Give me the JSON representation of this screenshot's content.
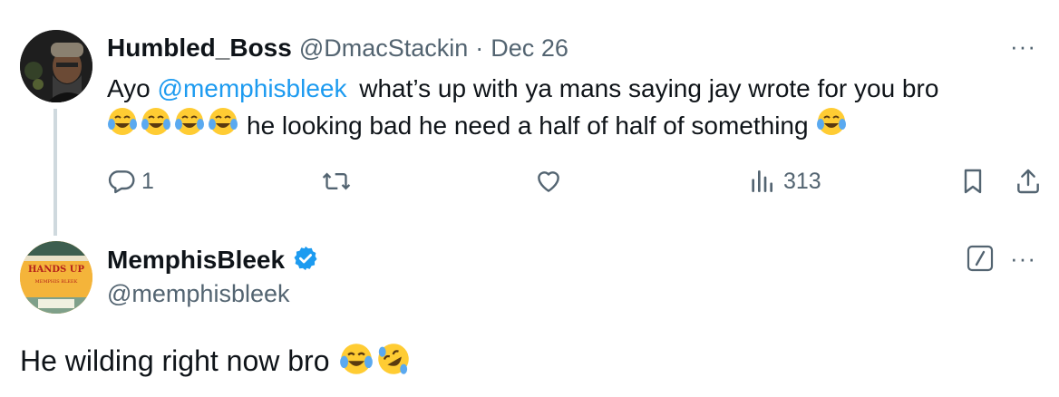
{
  "tweet1": {
    "display_name": "Humbled_Boss",
    "handle": "@DmacStackin",
    "separator": "·",
    "date": "Dec 26",
    "text_part1": "Ayo",
    "mention": "@memphisbleek",
    "text_part2": "what’s up with ya mans saying jay wrote for you bro",
    "text_part3": "he looking bad he need a half of half of something",
    "more_label": "···",
    "reply_count": "1",
    "view_count": "313",
    "icons": [
      "reply-icon",
      "retweet-icon",
      "like-icon",
      "views-icon",
      "bookmark-icon",
      "share-icon"
    ]
  },
  "tweet2": {
    "display_name": "MemphisBleek",
    "handle": "@memphisbleek",
    "text": "He wilding right now bro",
    "more_label": "···",
    "avatar_text": "HANDS UP",
    "avatar_subtext": "MEMPHIS BLEEK"
  },
  "colors": {
    "text": "#0f1419",
    "secondary": "#536471",
    "accent": "#1d9bf0",
    "thread_line": "#cfd9de"
  }
}
